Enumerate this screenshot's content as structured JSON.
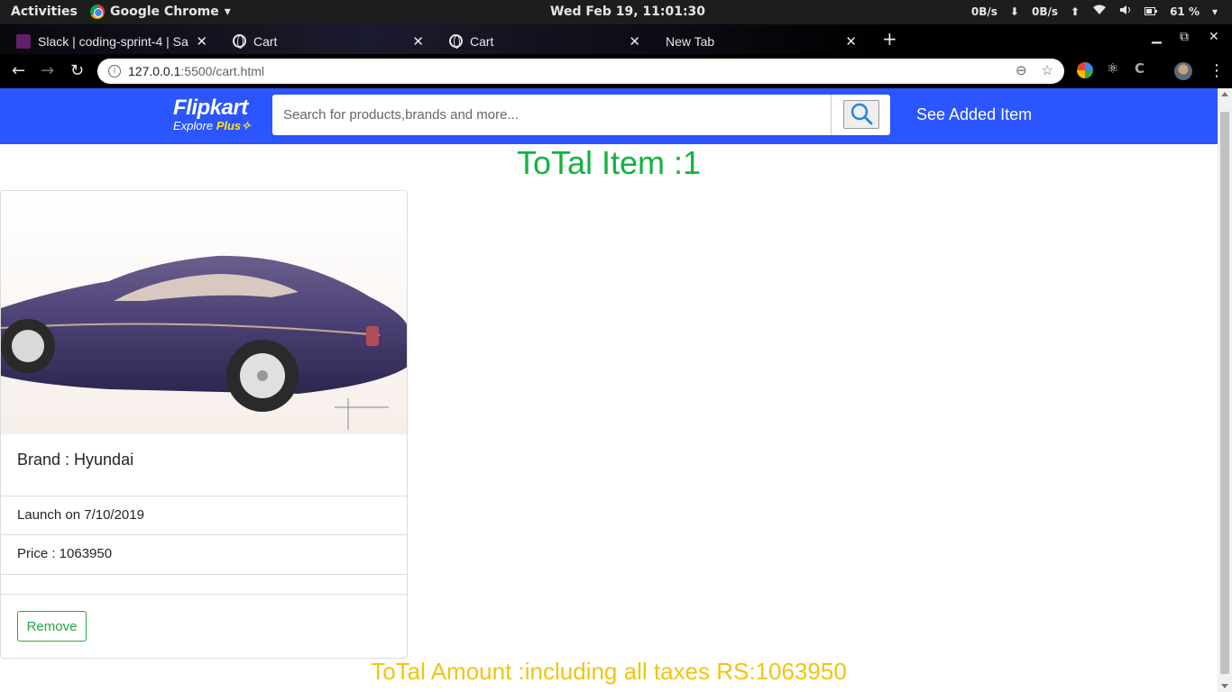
{
  "desktop": {
    "activities": "Activities",
    "app_name": "Google Chrome",
    "clock": "Wed Feb 19, 11:01:30",
    "net_down": "0B/s",
    "net_up": "0B/s",
    "battery": "61 %"
  },
  "browser": {
    "tabs": [
      {
        "title": "Slack | coding-sprint-4 | Sa",
        "icon": "slack-icon"
      },
      {
        "title": "Cart",
        "icon": "globe-icon"
      },
      {
        "title": "Cart",
        "icon": "globe-icon"
      },
      {
        "title": "New Tab",
        "icon": ""
      }
    ],
    "url_host": "127.0.0.1",
    "url_path": ":5500/cart.html"
  },
  "header": {
    "logo_name": "Flipkart",
    "logo_sub": "Explore",
    "logo_plus": "Plus",
    "search_placeholder": "Search for products,brands and more...",
    "see_added": "See Added Item",
    "brand_color": "#2a55ff"
  },
  "cart": {
    "total_item": "ToTal Item :1",
    "items": [
      {
        "brand": "Brand : Hyundai",
        "launch": "Launch on 7/10/2019",
        "price": "Price : 1063950",
        "remove_label": "Remove"
      }
    ],
    "total_amount": "ToTal Amount :including all taxes RS:1063950"
  },
  "colors": {
    "total_item": "#12b33f",
    "total_amount": "#f1c40f",
    "remove": "#28a745"
  }
}
